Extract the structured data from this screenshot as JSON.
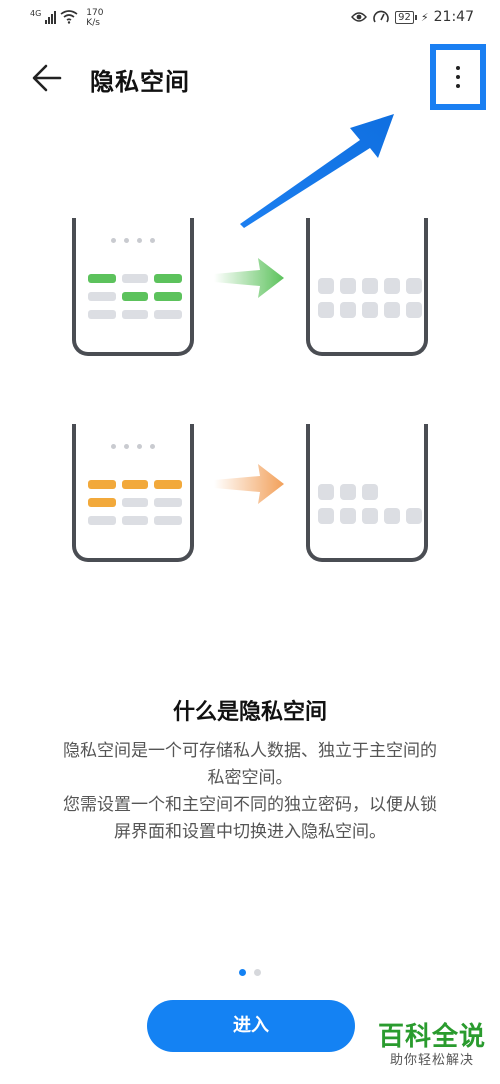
{
  "status_bar": {
    "network": "4G",
    "speed_value": "170",
    "speed_unit": "K/s",
    "battery": "92",
    "time": "21:47"
  },
  "header": {
    "title": "隐私空间"
  },
  "icons": {
    "back": "arrow-left-icon",
    "more": "more-vertical-icon",
    "annotation": "blue-arrow-annotation"
  },
  "colors": {
    "accent": "#1482f3",
    "highlight_box": "#1a7ff2",
    "green": "#5cc25c",
    "orange": "#f2a93b",
    "watermark_green": "#2a9b2e"
  },
  "info": {
    "title": "什么是隐私空间",
    "line1": "隐私空间是一个可存储私人数据、独立于主空间的",
    "line2": "私密空间。",
    "line3": "您需设置一个和主空间不同的独立密码，以便从锁",
    "line4": "屏界面和设置中切换进入隐私空间。"
  },
  "pager": {
    "active_index": 0,
    "count": 2
  },
  "enter_button": {
    "label": "进入"
  },
  "watermark": {
    "main": "百科全说",
    "sub": "助你轻松解决"
  }
}
